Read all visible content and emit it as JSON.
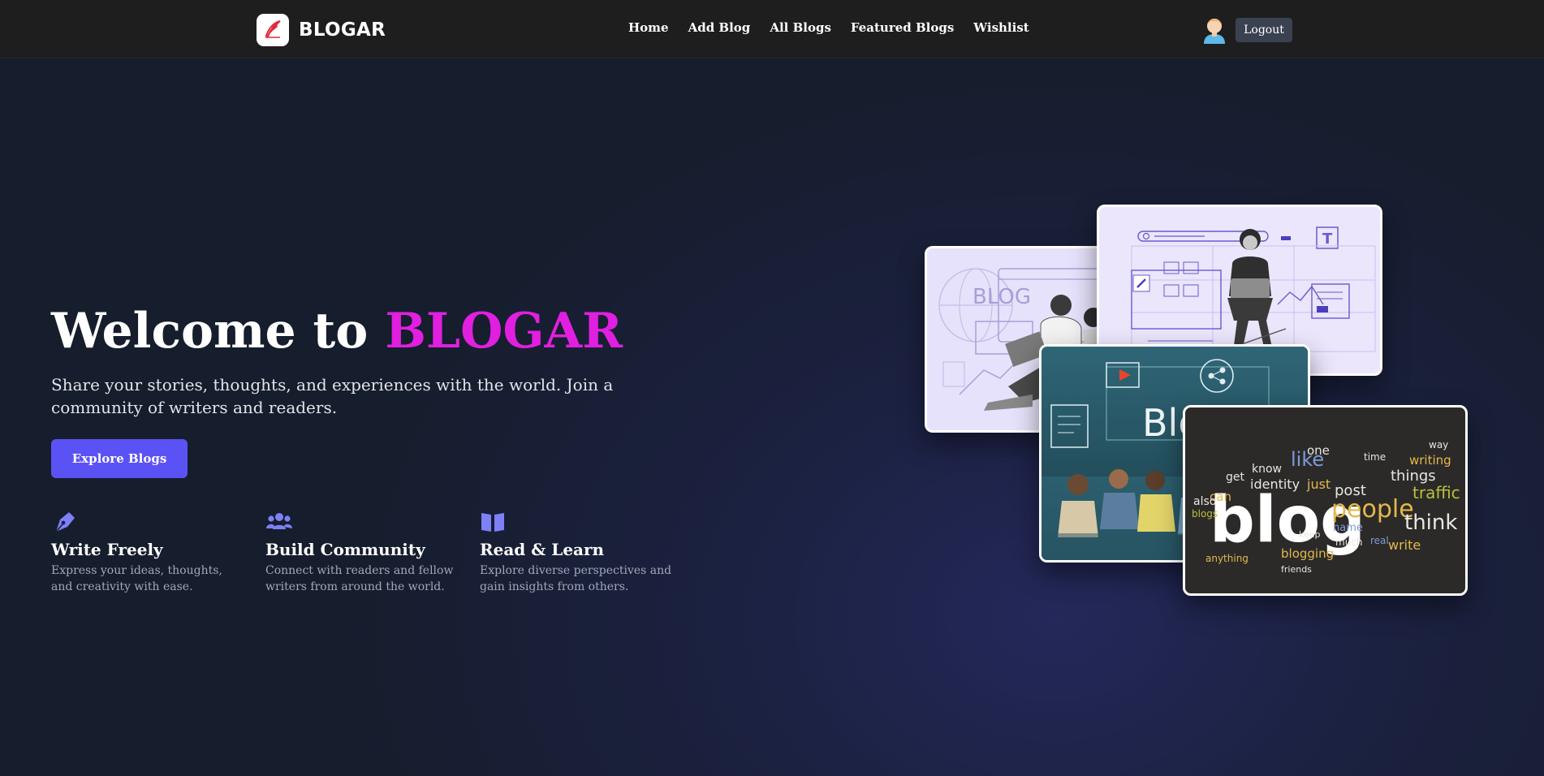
{
  "navbar": {
    "brand": "BLOGAR",
    "links": [
      "Home",
      "Add Blog",
      "All Blogs",
      "Featured Blogs",
      "Wishlist"
    ],
    "logout_label": "Logout"
  },
  "hero": {
    "title_prefix": "Welcome to ",
    "title_accent": "BLOGAR",
    "subtitle": "Share your stories, thoughts, and experiences with the world. Join a community of writers and readers.",
    "cta_label": "Explore Blogs"
  },
  "features": [
    {
      "icon": "pen-nib-icon",
      "title": "Write Freely",
      "desc": "Express your ideas, thoughts, and creativity with ease."
    },
    {
      "icon": "users-icon",
      "title": "Build Community",
      "desc": "Connect with readers and fellow writers from around the world."
    },
    {
      "icon": "book-open-icon",
      "title": "Read & Learn",
      "desc": "Explore diverse perspectives and gain insights from others."
    }
  ],
  "collage": {
    "card1_text": "BLOG",
    "card2_text": "T",
    "card3_text": "Blo",
    "card4_main": "blog",
    "card4_words": [
      "people",
      "think",
      "things",
      "traffic",
      "like",
      "identity",
      "post",
      "know",
      "writing",
      "blogging",
      "friends",
      "anything",
      "write",
      "keep",
      "just",
      "one",
      "can",
      "get",
      "much",
      "real",
      "also",
      "name",
      "blogs",
      "time",
      "way"
    ]
  },
  "colors": {
    "accent": "#e11fe0",
    "button": "#5b52f5",
    "icon": "#7d80f7",
    "navbar": "#1e1e1e"
  }
}
